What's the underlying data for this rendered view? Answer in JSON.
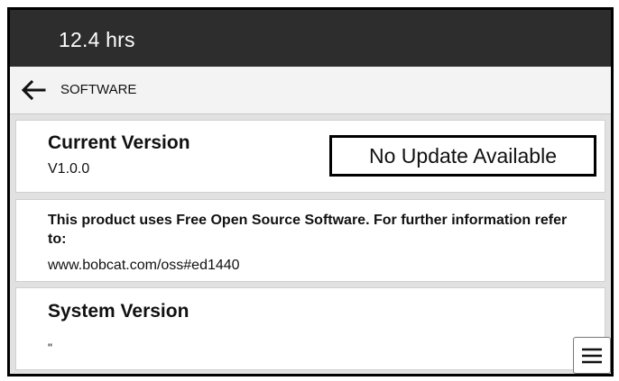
{
  "header": {
    "hours": "12.4 hrs"
  },
  "nav": {
    "back_icon": "arrow-left-icon",
    "title": "SOFTWARE"
  },
  "current_version": {
    "heading": "Current Version",
    "value": "V1.0.0",
    "update_status": "No Update Available"
  },
  "oss": {
    "notice": "This product uses Free Open Source Software. For further information refer to:",
    "link": "www.bobcat.com/oss#ed1440"
  },
  "system_version": {
    "heading": "System Version",
    "value": "\""
  },
  "menu": {
    "icon": "hamburger-menu-icon"
  }
}
